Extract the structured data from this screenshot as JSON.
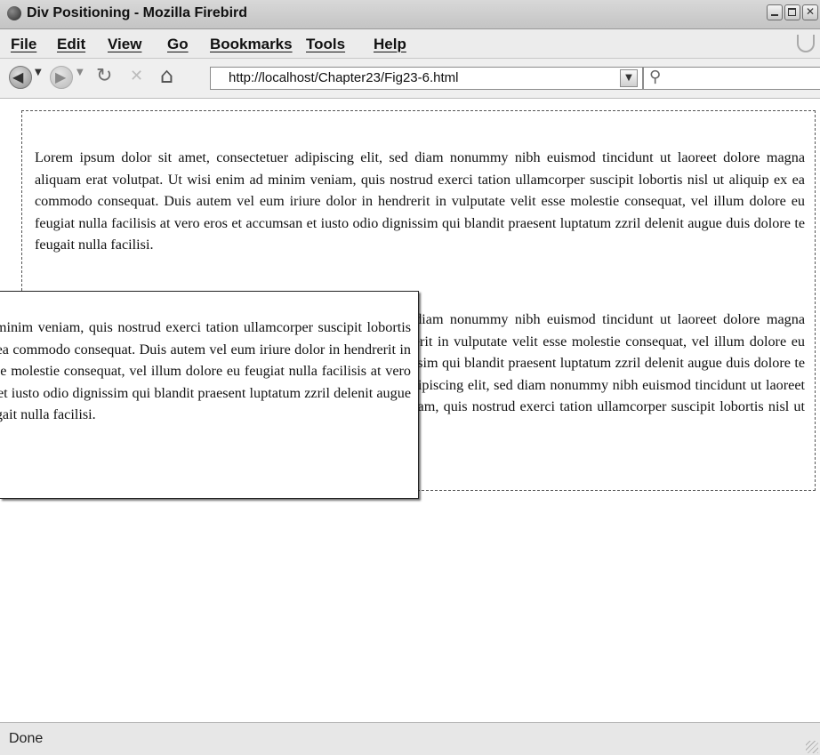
{
  "window": {
    "title": "Div Positioning - Mozilla Firebird"
  },
  "menu": {
    "items": [
      "File",
      "Edit",
      "View",
      "Go",
      "Bookmarks",
      "Tools",
      "Help"
    ]
  },
  "navigation": {
    "url": "http://localhost/Chapter23/Fig23-6.html"
  },
  "content": {
    "paragraph1": "Lorem ipsum dolor sit amet, consectetuer adipiscing elit, sed diam nonummy nibh euismod tincidunt ut laoreet dolore magna aliquam erat volutpat. Ut wisi enim ad minim veniam, quis nostrud exerci tation ullamcorper suscipit lobortis nisl ut aliquip ex ea commodo consequat. Duis autem vel eum iriure dolor in hendrerit in vulputate velit esse molestie consequat, vel illum dolore eu feugiat nulla facilisis at vero eros et accumsan et iusto odio dignissim qui blandit praesent luptatum zzril delenit augue duis dolore te feugait nulla facilisi.",
    "paragraph2": "Lorem ipsum dolor sit amet, consectetuer adipiscing elit, sed diam nonummy nibh euismod tincidunt ut laoreet dolore magna aliquam erat volutpat. Duis autem vel eum iriure dolor in hendrerit in vulputate velit esse molestie consequat, vel illum dolore eu feugiat nulla facilisis at vero eros et accumsan et iusto odio dignissim qui blandit praesent luptatum zzril delenit augue duis dolore te feugait nulla facilisi. Lorem ipsum dolor sit amet, consectetuer adipiscing elit, sed diam nonummy nibh euismod tincidunt ut laoreet dolore magna aliquam erat volutpat. Ut wisi enim ad minim veniam, quis nostrud exerci tation ullamcorper suscipit lobortis nisl ut aliquip ex ea commodo consequat.",
    "popup": "Ut wisi enim ad minim veniam, quis nostrud exerci tation ullamcorper suscipit lobortis nisl ut aliquip ex ea commodo consequat. Duis autem vel eum iriure dolor in hendrerit in vulputate velit esse molestie consequat, vel illum dolore eu feugiat nulla facilisis at vero eros et accumsan et iusto odio dignissim qui blandit praesent luptatum zzril delenit augue duis dolore te feugait nulla facilisi."
  },
  "status": {
    "text": "Done"
  },
  "icons": {
    "back": "back-icon",
    "forward": "forward-icon",
    "reload": "reload-icon",
    "stop": "stop-icon",
    "home": "home-icon",
    "search": "search-icon"
  }
}
